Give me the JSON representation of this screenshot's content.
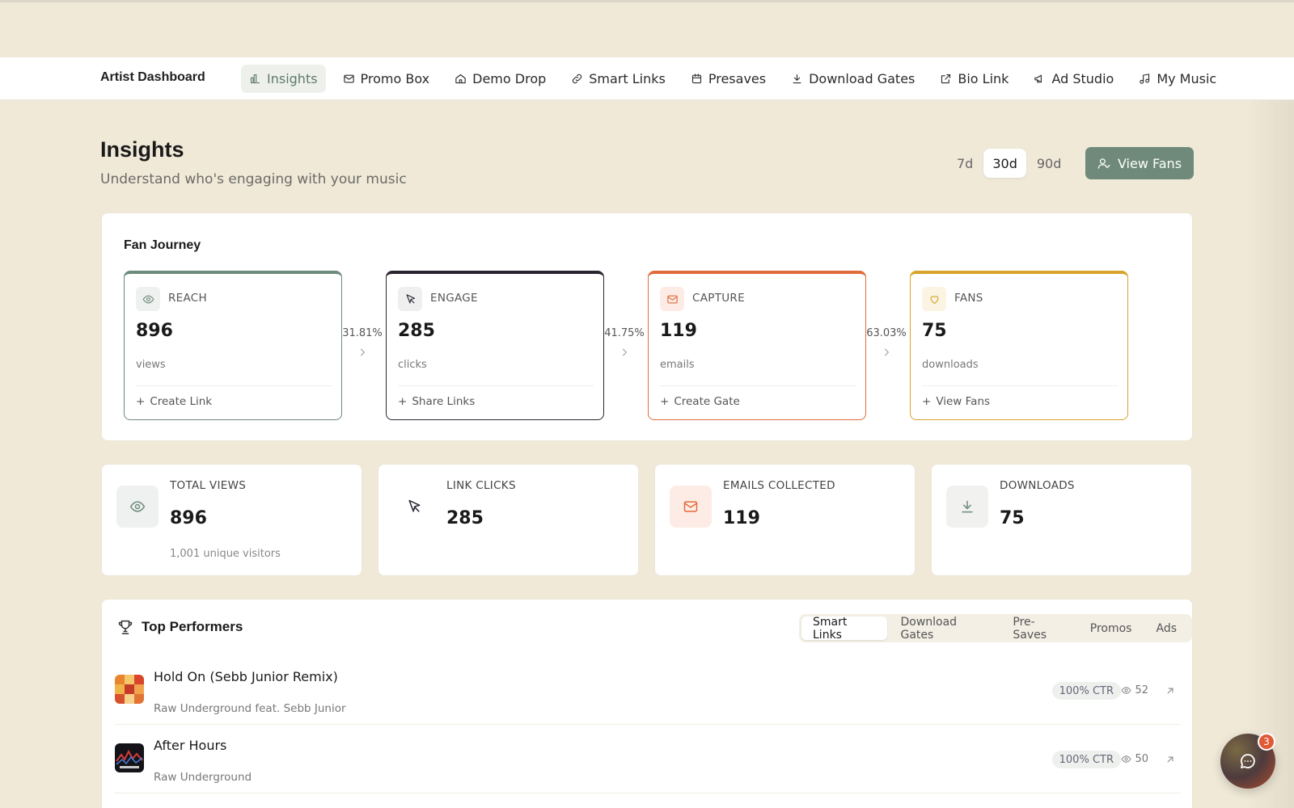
{
  "app": {
    "title": "Artist Dashboard"
  },
  "nav": {
    "items": [
      {
        "label": "Insights",
        "icon": "bar-chart-icon",
        "active": true
      },
      {
        "label": "Promo Box",
        "icon": "mail-icon"
      },
      {
        "label": "Demo Drop",
        "icon": "home-icon"
      },
      {
        "label": "Smart Links",
        "icon": "link-icon"
      },
      {
        "label": "Presaves",
        "icon": "calendar-icon"
      },
      {
        "label": "Download Gates",
        "icon": "download-icon"
      },
      {
        "label": "Bio Link",
        "icon": "external-link-icon"
      },
      {
        "label": "Ad Studio",
        "icon": "megaphone-icon"
      },
      {
        "label": "My Music",
        "icon": "music-note-icon"
      }
    ]
  },
  "header": {
    "title": "Insights",
    "subtitle": "Understand who's engaging with your music",
    "ranges": [
      "7d",
      "30d",
      "90d"
    ],
    "selected_range": "30d",
    "view_fans_label": "View Fans"
  },
  "fan_journey": {
    "title": "Fan Journey",
    "stages": [
      {
        "label": "REACH",
        "value": "896",
        "unit": "views",
        "action": "Create Link",
        "color": "#6d8a7c",
        "icon": "eye-icon"
      },
      {
        "label": "ENGAGE",
        "value": "285",
        "unit": "clicks",
        "action": "Share Links",
        "color": "#2a2430",
        "icon": "cursor-icon"
      },
      {
        "label": "CAPTURE",
        "value": "119",
        "unit": "emails",
        "action": "Create Gate",
        "color": "#e06b3a",
        "icon": "mail-icon"
      },
      {
        "label": "FANS",
        "value": "75",
        "unit": "downloads",
        "action": "View Fans",
        "color": "#d8a32a",
        "icon": "heart-icon"
      }
    ],
    "conversions": [
      "31.81%",
      "41.75%",
      "63.03%"
    ]
  },
  "stats": [
    {
      "label": "TOTAL VIEWS",
      "value": "896",
      "sub": "1,001 unique visitors",
      "icon": "eye-icon"
    },
    {
      "label": "LINK CLICKS",
      "value": "285",
      "sub": "",
      "icon": "cursor-icon"
    },
    {
      "label": "EMAILS COLLECTED",
      "value": "119",
      "sub": "",
      "icon": "mail-icon"
    },
    {
      "label": "DOWNLOADS",
      "value": "75",
      "sub": "",
      "icon": "download-icon"
    }
  ],
  "top_performers": {
    "title": "Top Performers",
    "tabs": [
      "Smart Links",
      "Download Gates",
      "Pre-Saves",
      "Promos",
      "Ads"
    ],
    "active_tab": "Smart Links",
    "rows": [
      {
        "title": "Hold On (Sebb Junior Remix)",
        "artist": "Raw Underground feat. Sebb Junior",
        "ctr": "100% CTR",
        "views": "52"
      },
      {
        "title": "After Hours",
        "artist": "Raw Underground",
        "ctr": "100% CTR",
        "views": "50"
      }
    ]
  },
  "chat": {
    "badge": "3"
  },
  "colors": {
    "accent": "#6f8a7a",
    "background": "#f0e9d8",
    "capture": "#e06b3a",
    "fans": "#d8a32a"
  }
}
